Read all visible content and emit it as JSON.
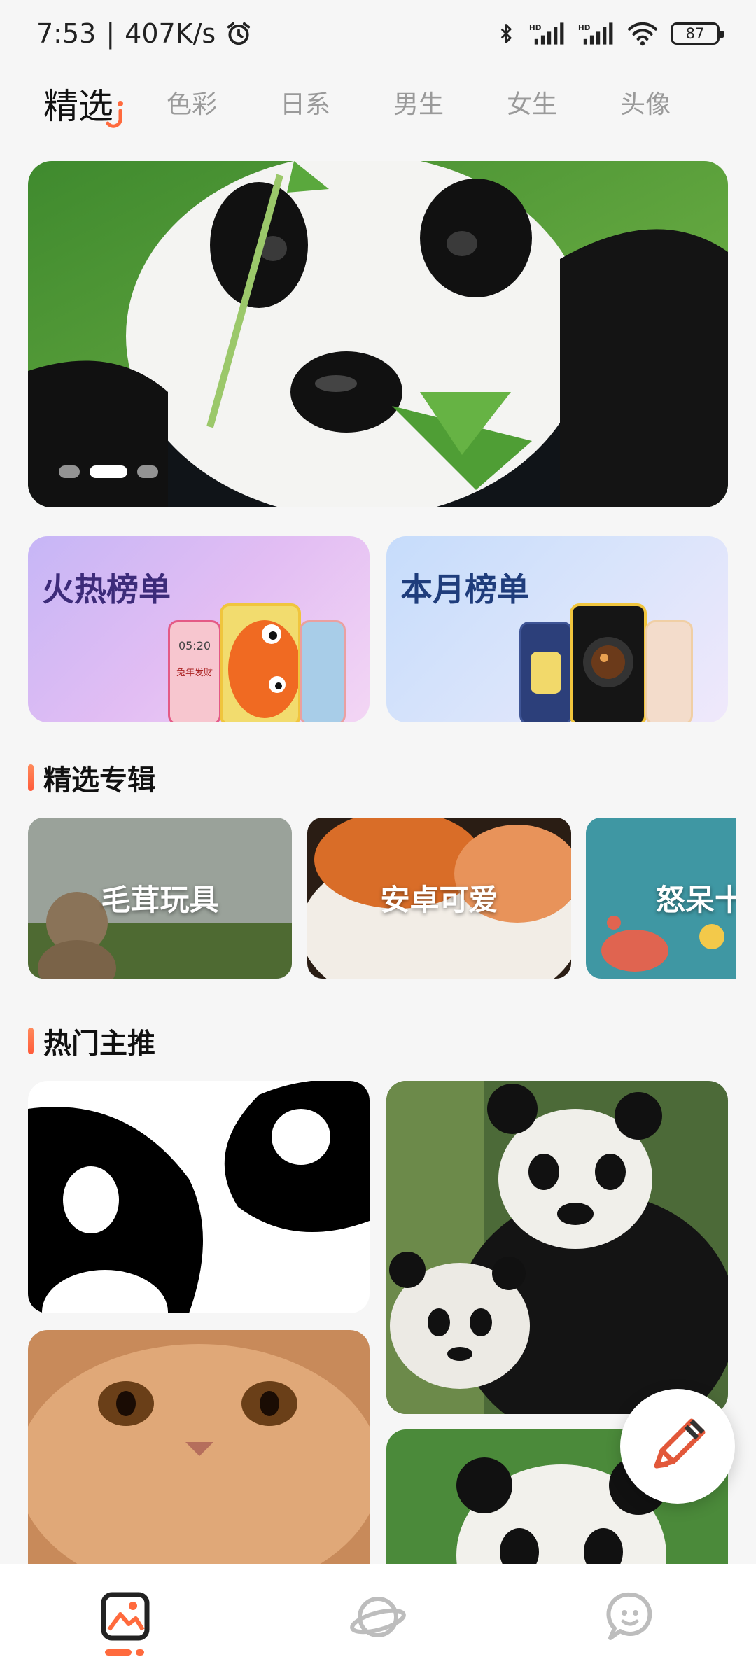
{
  "status": {
    "time": "7:53",
    "speed": "407K/s",
    "battery": "87",
    "icons": [
      "alarm-icon",
      "bluetooth-icon",
      "signal-hd-icon",
      "signal-hd-icon",
      "wifi-icon",
      "battery-icon"
    ]
  },
  "tabs": {
    "active": "精选",
    "items": [
      "色彩",
      "日系",
      "男生",
      "女生",
      "头像"
    ]
  },
  "banner": {
    "subject": "panda-photo",
    "dots": 3,
    "active_dot": 1
  },
  "rankings": [
    {
      "title": "火热榜单",
      "phone_clock": "05:20",
      "phone_caption": "兔年发财"
    },
    {
      "title": "本月榜单"
    }
  ],
  "albums_section": {
    "title": "精选专辑",
    "items": [
      "毛茸玩具",
      "安卓可爱",
      "怒呆十"
    ]
  },
  "hot_section": {
    "title": "热门主推"
  },
  "fab": {
    "icon": "pencil-icon"
  },
  "bottom_nav": {
    "items": [
      "wallpaper-icon",
      "planet-icon",
      "chat-icon"
    ],
    "active": 0
  },
  "colors": {
    "accent": "#ff6a3d",
    "background": "#f6f6f6",
    "tab_inactive": "#9a9a9a"
  }
}
